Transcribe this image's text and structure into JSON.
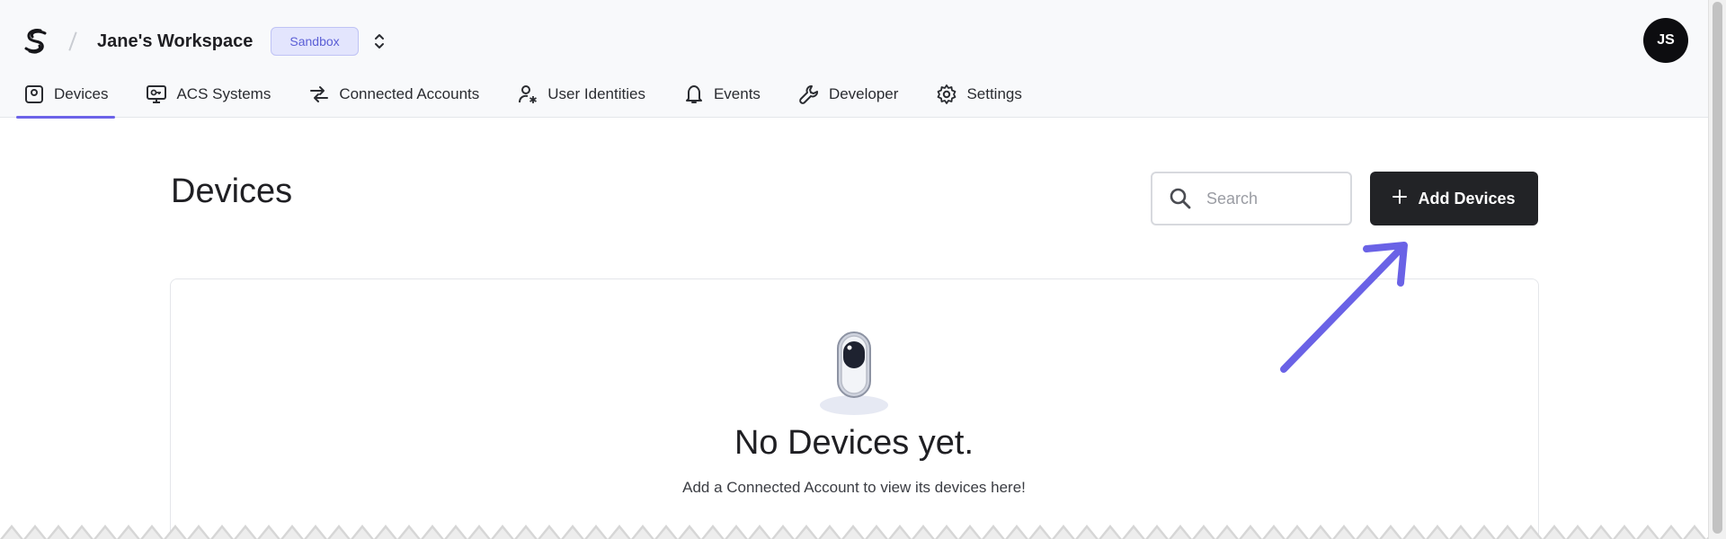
{
  "header": {
    "workspace_name": "Jane's Workspace",
    "badge": "Sandbox",
    "avatar_initials": "JS"
  },
  "tabs": [
    {
      "label": "Devices",
      "icon": "device-icon",
      "active": true
    },
    {
      "label": "ACS Systems",
      "icon": "acs-monitor-icon",
      "active": false
    },
    {
      "label": "Connected Accounts",
      "icon": "arrows-exchange-icon",
      "active": false
    },
    {
      "label": "User Identities",
      "icon": "user-asterisk-icon",
      "active": false
    },
    {
      "label": "Events",
      "icon": "bell-icon",
      "active": false
    },
    {
      "label": "Developer",
      "icon": "wrench-icon",
      "active": false
    },
    {
      "label": "Settings",
      "icon": "gear-icon",
      "active": false
    }
  ],
  "main": {
    "title": "Devices",
    "search_placeholder": "Search",
    "add_button_label": "Add Devices",
    "empty_title": "No Devices yet.",
    "empty_subtitle": "Add a Connected Account to view its devices here!"
  },
  "colors": {
    "accent": "#6c63e8",
    "badge_bg": "#e3e5fd",
    "button_bg": "#222326",
    "annotation_arrow": "#6a62e6"
  }
}
